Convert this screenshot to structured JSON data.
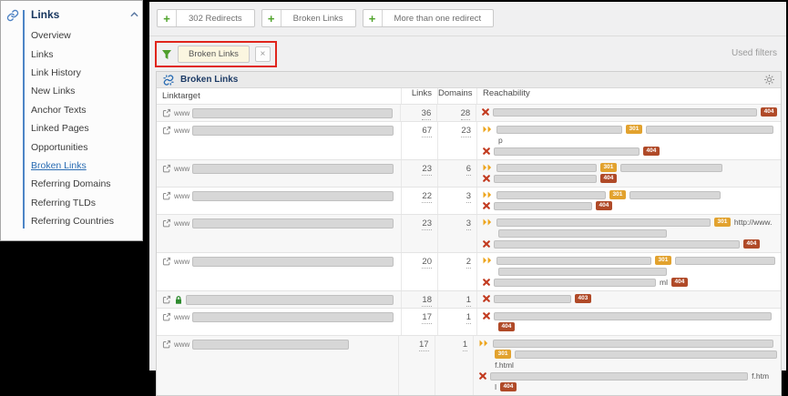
{
  "colors": {
    "accent_green": "#50a32b",
    "link_blue": "#2a6cb3",
    "navy_title": "#1d3b66",
    "badge_redirect": "#e2a22e",
    "badge_error": "#b04a28",
    "error_x": "#c23a1f",
    "redirect_arrow": "#eda41b",
    "annotation_red": "#e0251c"
  },
  "sidebar": {
    "section_title": "Links",
    "items": [
      {
        "label": "Overview",
        "active": false
      },
      {
        "label": "Links",
        "active": false
      },
      {
        "label": "Link History",
        "active": false
      },
      {
        "label": "New Links",
        "active": false
      },
      {
        "label": "Anchor Texts",
        "active": false
      },
      {
        "label": "Linked Pages",
        "active": false
      },
      {
        "label": "Opportunities",
        "active": false
      },
      {
        "label": "Broken Links",
        "active": true
      },
      {
        "label": "Referring Domains",
        "active": false
      },
      {
        "label": "Referring TLDs",
        "active": false
      },
      {
        "label": "Referring Countries",
        "active": false
      }
    ]
  },
  "filter_bar": {
    "add_buttons": [
      {
        "label": "302 Redirects"
      },
      {
        "label": "Broken Links"
      },
      {
        "label": "More than one redirect"
      }
    ],
    "active_chip": {
      "label": "Broken Links",
      "close": "×"
    },
    "used_filters_label": "Used filters"
  },
  "table": {
    "title": "Broken Links",
    "columns": {
      "linktarget": "Linktarget",
      "links": "Links",
      "domains": "Domains",
      "reachability": "Reachability"
    },
    "rows": [
      {
        "prefix": "www",
        "secure": false,
        "target_bar": "auto",
        "links": "36",
        "domains": "28",
        "reach": [
          {
            "icon": "error",
            "segs": [
              {
                "bar": 290
              },
              {
                "badge": "404"
              }
            ]
          }
        ]
      },
      {
        "prefix": "www",
        "secure": false,
        "target_bar": "auto",
        "links": "67",
        "domains": "23",
        "reach": [
          {
            "icon": "redirect",
            "segs": [
              {
                "bar": 138
              },
              {
                "badge": "301"
              },
              {
                "bar": 140
              }
            ]
          },
          {
            "icon": "none",
            "segs": [
              {
                "text": "p"
              }
            ]
          },
          {
            "icon": "error",
            "segs": [
              {
                "bar": 160
              },
              {
                "badge": "404"
              }
            ]
          }
        ]
      },
      {
        "prefix": "www",
        "secure": false,
        "target_bar": "auto",
        "links": "23",
        "domains": "6",
        "reach": [
          {
            "icon": "redirect",
            "segs": [
              {
                "bar": 110
              },
              {
                "badge": "301"
              },
              {
                "bar": 112
              }
            ]
          },
          {
            "icon": "error",
            "segs": [
              {
                "bar": 113
              },
              {
                "badge": "404"
              }
            ]
          }
        ]
      },
      {
        "prefix": "www",
        "secure": false,
        "target_bar": "auto",
        "links": "22",
        "domains": "3",
        "reach": [
          {
            "icon": "redirect",
            "segs": [
              {
                "bar": 120
              },
              {
                "badge": "301"
              },
              {
                "bar": 100
              }
            ]
          },
          {
            "icon": "error",
            "segs": [
              {
                "bar": 108
              },
              {
                "badge": "404"
              }
            ]
          }
        ]
      },
      {
        "prefix": "www",
        "secure": false,
        "target_bar": "auto",
        "links": "23",
        "domains": "3",
        "reach": [
          {
            "icon": "redirect",
            "segs": [
              {
                "bar": 235
              },
              {
                "badge": "301"
              },
              {
                "text": "http://www."
              }
            ]
          },
          {
            "icon": "none",
            "segs": [
              {
                "bar": 185
              }
            ]
          },
          {
            "icon": "error",
            "segs": [
              {
                "bar": 270
              },
              {
                "badge": "404"
              }
            ]
          }
        ]
      },
      {
        "prefix": "www",
        "secure": false,
        "target_bar": "auto",
        "links": "20",
        "domains": "2",
        "reach": [
          {
            "icon": "redirect",
            "segs": [
              {
                "bar": 170
              },
              {
                "badge": "301"
              },
              {
                "bar": 110
              }
            ]
          },
          {
            "icon": "none",
            "segs": [
              {
                "bar": 185
              }
            ]
          },
          {
            "icon": "error",
            "segs": [
              {
                "bar": 178
              },
              {
                "text": "ml"
              },
              {
                "badge": "404"
              }
            ]
          }
        ]
      },
      {
        "prefix": "",
        "secure": true,
        "target_bar": "auto",
        "links": "18",
        "domains": "1",
        "reach": [
          {
            "icon": "error",
            "segs": [
              {
                "bar": 85
              },
              {
                "badge": "403"
              }
            ]
          }
        ]
      },
      {
        "prefix": "www",
        "secure": false,
        "target_bar": "auto",
        "links": "17",
        "domains": "1",
        "reach": [
          {
            "icon": "error",
            "segs": [
              {
                "bar": 305
              }
            ]
          },
          {
            "icon": "none",
            "segs": [
              {
                "badge": "404"
              }
            ]
          }
        ]
      },
      {
        "prefix": "www",
        "secure": false,
        "target_bar": 172,
        "links": "17",
        "domains": "1",
        "reach": [
          {
            "icon": "redirect",
            "segs": [
              {
                "bar": 308
              }
            ]
          },
          {
            "icon": "none",
            "segs": [
              {
                "badge": "301"
              },
              {
                "bar": 288
              }
            ]
          },
          {
            "icon": "none",
            "segs": [
              {
                "text": "f.html"
              }
            ]
          },
          {
            "icon": "error",
            "segs": [
              {
                "bar": 283
              },
              {
                "text": "f.htm"
              }
            ]
          },
          {
            "icon": "none",
            "segs": [
              {
                "text": "l"
              },
              {
                "badge": "404"
              }
            ]
          }
        ]
      }
    ]
  }
}
